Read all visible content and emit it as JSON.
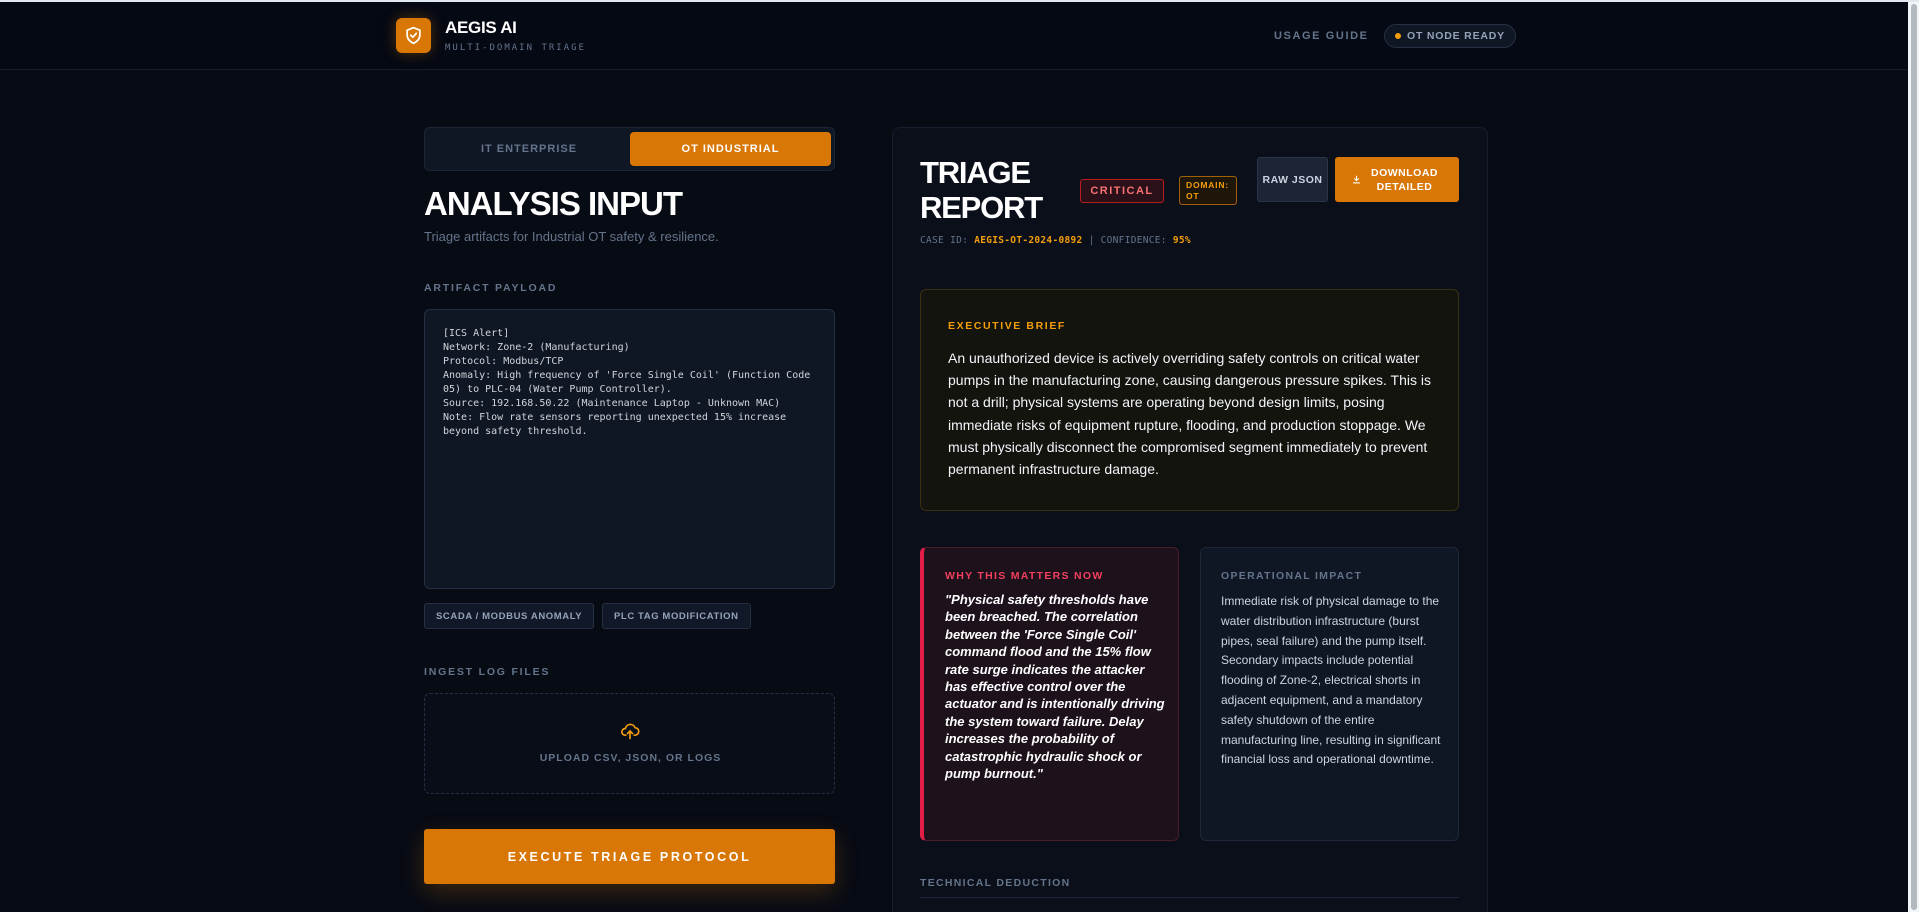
{
  "header": {
    "brand_title": "AEGIS AI",
    "brand_subtitle": "MULTI-DOMAIN TRIAGE",
    "usage_guide": "USAGE GUIDE",
    "node_status": "OT NODE READY"
  },
  "input": {
    "tabs": [
      {
        "label": "IT ENTERPRISE",
        "active": false
      },
      {
        "label": "OT INDUSTRIAL",
        "active": true
      }
    ],
    "title": "ANALYSIS INPUT",
    "subtitle": "Triage artifacts for Industrial OT safety & resilience.",
    "payload_label": "ARTIFACT PAYLOAD",
    "payload": "[ICS Alert]\nNetwork: Zone-2 (Manufacturing)\nProtocol: Modbus/TCP\nAnomaly: High frequency of 'Force Single Coil' (Function Code 05) to PLC-04 (Water Pump Controller).\nSource: 192.168.50.22 (Maintenance Laptop - Unknown MAC)\nNote: Flow rate sensors reporting unexpected 15% increase beyond safety threshold.",
    "tags": [
      "SCADA / MODBUS ANOMALY",
      "PLC TAG MODIFICATION"
    ],
    "ingest_label": "INGEST LOG FILES",
    "upload_text": "UPLOAD CSV, JSON, OR LOGS",
    "execute_label": "EXECUTE TRIAGE PROTOCOL"
  },
  "report": {
    "title": "TRIAGE REPORT",
    "severity": "CRITICAL",
    "domain_badge": "DOMAIN: OT",
    "raw_json_label": "RAW JSON",
    "download_label": "DOWNLOAD DETAILED",
    "case_id_label": "CASE ID:",
    "case_id": "AEGIS-OT-2024-0892",
    "confidence_label": "| CONFIDENCE:",
    "confidence": "95%",
    "brief_label": "EXECUTIVE BRIEF",
    "brief_text": "An unauthorized device is actively overriding safety controls on critical water pumps in the manufacturing zone, causing dangerous pressure spikes. This is not a drill; physical systems are operating beyond design limits, posing immediate risks of equipment rupture, flooding, and production stoppage. We must physically disconnect the compromised segment immediately to prevent permanent infrastructure damage.",
    "why_label": "WHY THIS MATTERS NOW",
    "why_text": "\"Physical safety thresholds have been breached. The correlation between the 'Force Single Coil' command flood and the 15% flow rate surge indicates the attacker has effective control over the actuator and is intentionally driving the system toward failure. Delay increases the probability of catastrophic hydraulic shock or pump burnout.\"",
    "impact_label": "OPERATIONAL IMPACT",
    "impact_text": "Immediate risk of physical damage to the water distribution infrastructure (burst pipes, seal failure) and the pump itself. Secondary impacts include potential flooding of Zone-2, electrical shorts in adjacent equipment, and a mandatory safety shutdown of the entire manufacturing line, resulting in significant financial loss and operational downtime.",
    "tech_label": "TECHNICAL DEDUCTION"
  },
  "colors": {
    "accent": "#d97706",
    "critical": "#f43f5e",
    "background": "#070b14"
  },
  "icons": {
    "logo": "shield-check-icon",
    "upload": "cloud-upload-icon",
    "download": "download-icon",
    "status": "status-dot-icon"
  }
}
